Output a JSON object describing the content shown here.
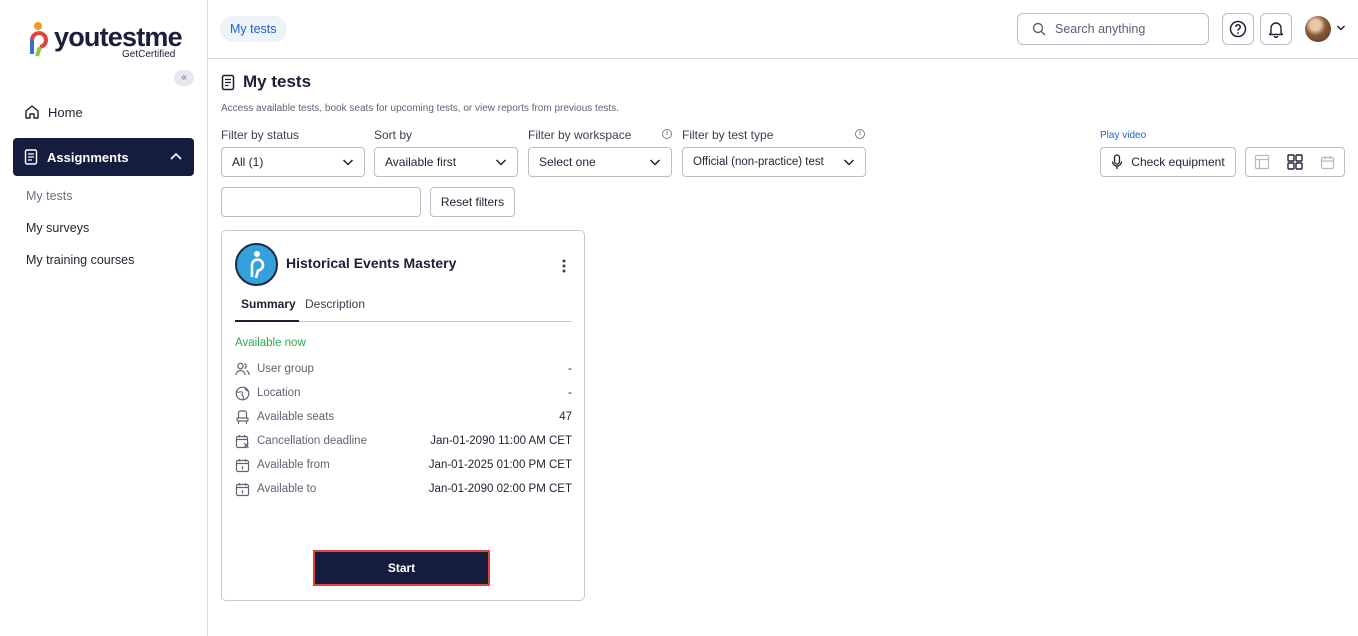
{
  "logo": {
    "brand_pre": "youtest",
    "brand_post": "me",
    "tagline": "GetCertified"
  },
  "sidebar": {
    "collapse_glyph": "«",
    "home": "Home",
    "assignments": "Assignments",
    "sub_items": [
      "My tests",
      "My surveys",
      "My training courses"
    ]
  },
  "topbar": {
    "breadcrumb": "My tests",
    "search_placeholder": "Search anything"
  },
  "page": {
    "title": "My tests",
    "description": "Access available tests, book seats for upcoming tests, or view reports from previous tests."
  },
  "filters": {
    "status": {
      "label": "Filter by status",
      "value": "All (1)"
    },
    "sort": {
      "label": "Sort by",
      "value": "Available first"
    },
    "workspace": {
      "label": "Filter by workspace",
      "value": "Select one"
    },
    "test_type": {
      "label": "Filter by test type",
      "value": "Official (non-practice) test"
    },
    "text_value": "",
    "reset": "Reset filters"
  },
  "equipment": {
    "play_video": "Play video",
    "check": "Check equipment"
  },
  "card": {
    "title": "Historical Events Mastery",
    "tabs": [
      "Summary",
      "Description"
    ],
    "status": "Available now",
    "rows": [
      {
        "icon": "user-group-icon",
        "label": "User group",
        "value": "-"
      },
      {
        "icon": "location-icon",
        "label": "Location",
        "value": "-"
      },
      {
        "icon": "seat-icon",
        "label": "Available seats",
        "value": "47"
      },
      {
        "icon": "calendar-cancel-icon",
        "label": "Cancellation deadline",
        "value": "Jan-01-2090 11:00 AM CET"
      },
      {
        "icon": "calendar-icon",
        "label": "Available from",
        "value": "Jan-01-2025 01:00 PM CET"
      },
      {
        "icon": "calendar-icon",
        "label": "Available to",
        "value": "Jan-01-2090 02:00 PM CET"
      }
    ],
    "start": "Start"
  },
  "colors": {
    "nav_active": "#151d3f",
    "accent": "#1e64c8",
    "available": "#2fa84f",
    "highlight": "#e0443c"
  }
}
